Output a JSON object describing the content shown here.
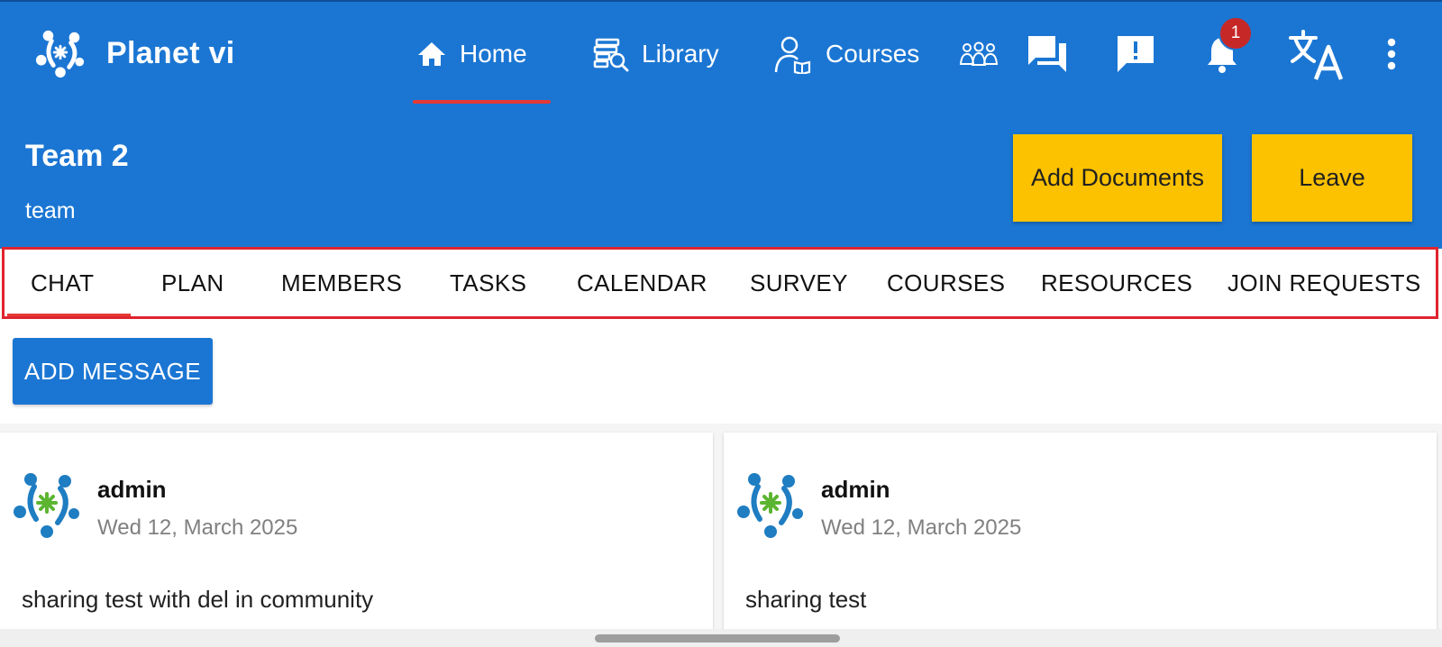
{
  "app": {
    "name": "Planet vi"
  },
  "nav": {
    "home": "Home",
    "library": "Library",
    "courses": "Courses",
    "notification_count": "1"
  },
  "team": {
    "title": "Team 2",
    "subtitle": "team",
    "add_documents_label": "Add Documents",
    "leave_label": "Leave"
  },
  "tabs": [
    {
      "label": "CHAT",
      "selected": true
    },
    {
      "label": "PLAN"
    },
    {
      "label": "MEMBERS"
    },
    {
      "label": "TASKS"
    },
    {
      "label": "CALENDAR"
    },
    {
      "label": "SURVEY"
    },
    {
      "label": "COURSES"
    },
    {
      "label": "RESOURCES"
    },
    {
      "label": "JOIN REQUESTS"
    }
  ],
  "chat": {
    "add_message_label": "ADD MESSAGE",
    "messages": [
      {
        "author": "admin",
        "date": "Wed 12, March 2025",
        "text": "sharing test with del in community"
      },
      {
        "author": "admin",
        "date": "Wed 12, March 2025",
        "text": "sharing test"
      }
    ]
  },
  "colors": {
    "primary": "#1b76d3",
    "accent_yellow": "#fcc200",
    "indicator_red": "#e53935",
    "highlight_border": "#e0242f"
  },
  "icons": {
    "home": "home-icon",
    "library": "library-icon",
    "courses": "courses-icon",
    "community": "community-icon",
    "chat": "chat-icon",
    "feedback": "feedback-icon",
    "notifications": "bell-icon",
    "language": "translate-icon",
    "more": "more-vertical-icon"
  }
}
